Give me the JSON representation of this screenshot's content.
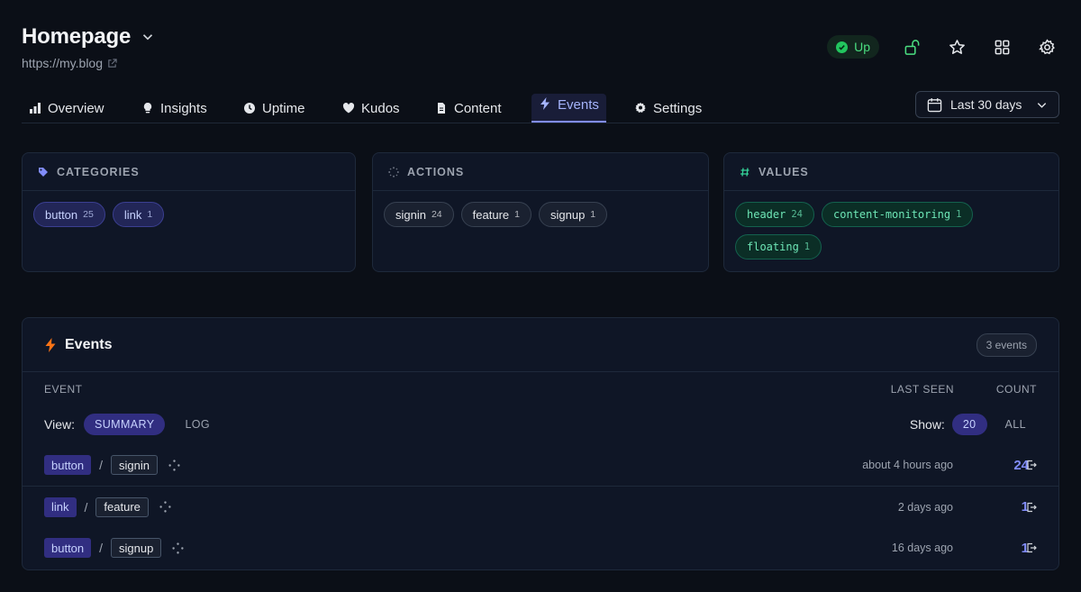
{
  "site": {
    "title": "Homepage",
    "url": "https://my.blog",
    "status": "Up"
  },
  "tabs": [
    {
      "label": "Overview",
      "icon": "bar-chart-icon"
    },
    {
      "label": "Insights",
      "icon": "lightbulb-icon"
    },
    {
      "label": "Uptime",
      "icon": "clock-icon"
    },
    {
      "label": "Kudos",
      "icon": "heart-icon"
    },
    {
      "label": "Content",
      "icon": "document-icon"
    },
    {
      "label": "Events",
      "icon": "lightning-icon",
      "active": true
    },
    {
      "label": "Settings",
      "icon": "gear-icon"
    }
  ],
  "date_range": "Last 30 days",
  "facets": {
    "categories": {
      "title": "CATEGORIES",
      "items": [
        {
          "label": "button",
          "count": "25"
        },
        {
          "label": "link",
          "count": "1"
        }
      ]
    },
    "actions": {
      "title": "ACTIONS",
      "items": [
        {
          "label": "signin",
          "count": "24"
        },
        {
          "label": "feature",
          "count": "1"
        },
        {
          "label": "signup",
          "count": "1"
        }
      ]
    },
    "values": {
      "title": "VALUES",
      "items": [
        {
          "label": "header",
          "count": "24"
        },
        {
          "label": "content-monitoring",
          "count": "1"
        },
        {
          "label": "floating",
          "count": "1"
        }
      ]
    }
  },
  "events": {
    "title": "Events",
    "badge": "3 events",
    "columns": {
      "event": "EVENT",
      "last_seen": "LAST SEEN",
      "count": "COUNT"
    },
    "view_label": "View:",
    "view_options": [
      "SUMMARY",
      "LOG"
    ],
    "show_label": "Show:",
    "show_options": [
      "20",
      "ALL"
    ],
    "rows": [
      {
        "category": "button",
        "action": "signin",
        "last_seen": "about 4 hours ago",
        "count": "24"
      },
      {
        "category": "link",
        "action": "feature",
        "last_seen": "2 days ago",
        "count": "1"
      },
      {
        "category": "button",
        "action": "signup",
        "last_seen": "16 days ago",
        "count": "1"
      }
    ],
    "separator": "/"
  },
  "colors": {
    "accent": "#818cf8",
    "status_green": "#4ade80",
    "event_icon": "#f97316",
    "background": "#0b0f17"
  }
}
